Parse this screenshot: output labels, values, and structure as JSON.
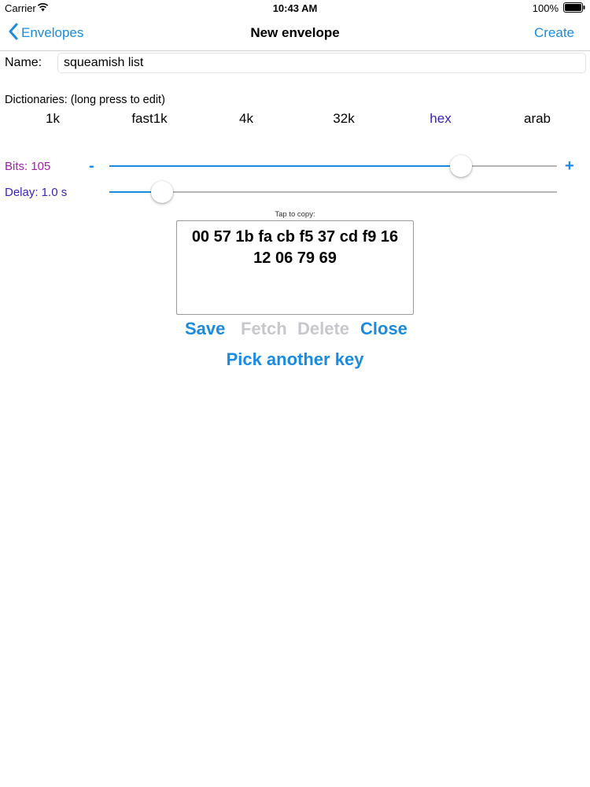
{
  "status_bar": {
    "carrier": "Carrier",
    "time": "10:43 AM",
    "battery": "100%"
  },
  "nav": {
    "back_label": "Envelopes",
    "title": "New envelope",
    "action_label": "Create"
  },
  "form": {
    "name_label": "Name:",
    "name_value": "squeamish list",
    "dictionaries_label": "Dictionaries:  (long press to edit)",
    "dictionaries": [
      "1k",
      "fast1k",
      "4k",
      "32k",
      "hex",
      "arab"
    ],
    "selected_dictionary": "hex"
  },
  "bits": {
    "label": "Bits: 105",
    "minus": "-",
    "plus": "+",
    "value": 105,
    "level": 0.785
  },
  "delay": {
    "label": "Delay: 1.0 s",
    "value": 1.0,
    "level": 0.118
  },
  "key": {
    "hint": "Tap to copy:",
    "lines": [
      "00 57 1b fa cb f5 37 cd f9 16",
      "12 06 79 69"
    ]
  },
  "actions": {
    "save": "Save",
    "fetch": "Fetch",
    "delete": "Delete",
    "close": "Close",
    "pick_another": "Pick another key"
  },
  "colors": {
    "accent": "#1b8be0",
    "bits_label": "#a01fa8",
    "delay_label": "#3a1fb8",
    "selected_dictionary": "#3a1fb8",
    "disabled": "#c8c8cc"
  }
}
